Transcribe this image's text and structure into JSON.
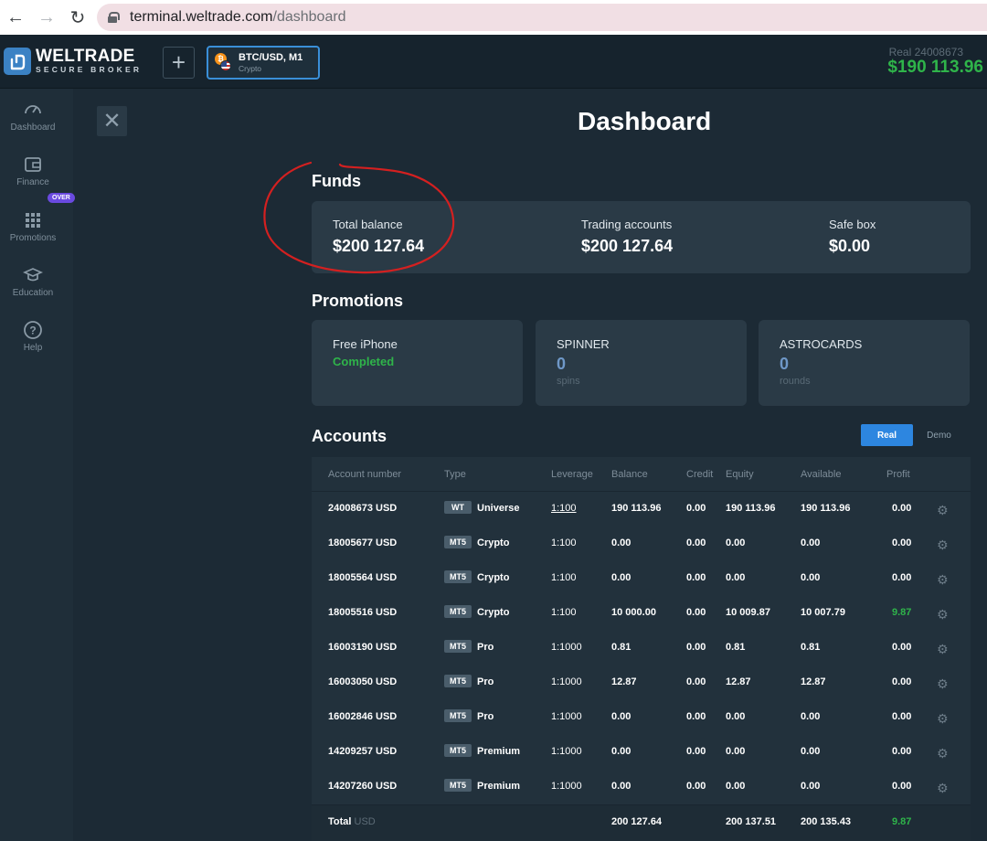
{
  "browser": {
    "url_host": "terminal.weltrade.com",
    "url_path": "/dashboard"
  },
  "header": {
    "logo_name": "WELTRADE",
    "logo_sub": "SECURE BROKER",
    "add_tab": "+",
    "instrument": {
      "name": "BTC/USD, M1",
      "category": "Crypto"
    },
    "account_label": "Real 24008673",
    "account_balance": "$190 113.96"
  },
  "sidebar": {
    "items": [
      {
        "label": "Dashboard",
        "icon": "speedometer-icon"
      },
      {
        "label": "Finance",
        "icon": "wallet-icon"
      },
      {
        "label": "Promotions",
        "icon": "grid-icon"
      },
      {
        "label": "Education",
        "icon": "graduation-cap-icon"
      },
      {
        "label": "Help",
        "icon": "help-circle-icon"
      }
    ],
    "badge": "OVER"
  },
  "page": {
    "title": "Dashboard",
    "close": "✕"
  },
  "funds": {
    "title": "Funds",
    "total_balance": {
      "label": "Total balance",
      "value": "$200 127.64"
    },
    "trading_accounts": {
      "label": "Trading accounts",
      "value": "$200 127.64"
    },
    "safe_box": {
      "label": "Safe box",
      "value": "$0.00"
    }
  },
  "promotions": {
    "title": "Promotions",
    "items": [
      {
        "name": "Free iPhone",
        "status": "Completed"
      },
      {
        "name": "SPINNER",
        "count": "0",
        "unit": "spins"
      },
      {
        "name": "ASTROCARDS",
        "count": "0",
        "unit": "rounds"
      }
    ]
  },
  "accounts": {
    "title": "Accounts",
    "toggle": {
      "real": "Real",
      "demo": "Demo"
    },
    "columns": [
      "Account number",
      "Type",
      "Leverage",
      "Balance",
      "Credit",
      "Equity",
      "Available",
      "Profit"
    ],
    "rows": [
      {
        "number": "24008673 USD",
        "platform": "WT",
        "type": "Universe",
        "leverage": "1:100",
        "balance": "190 113.96",
        "credit": "0.00",
        "equity": "190 113.96",
        "available": "190 113.96",
        "profit": "0.00"
      },
      {
        "number": "18005677 USD",
        "platform": "MT5",
        "type": "Crypto",
        "leverage": "1:100",
        "balance": "0.00",
        "credit": "0.00",
        "equity": "0.00",
        "available": "0.00",
        "profit": "0.00"
      },
      {
        "number": "18005564 USD",
        "platform": "MT5",
        "type": "Crypto",
        "leverage": "1:100",
        "balance": "0.00",
        "credit": "0.00",
        "equity": "0.00",
        "available": "0.00",
        "profit": "0.00"
      },
      {
        "number": "18005516 USD",
        "platform": "MT5",
        "type": "Crypto",
        "leverage": "1:100",
        "balance": "10 000.00",
        "credit": "0.00",
        "equity": "10 009.87",
        "available": "10 007.79",
        "profit": "9.87"
      },
      {
        "number": "16003190 USD",
        "platform": "MT5",
        "type": "Pro",
        "leverage": "1:1000",
        "balance": "0.81",
        "credit": "0.00",
        "equity": "0.81",
        "available": "0.81",
        "profit": "0.00"
      },
      {
        "number": "16003050 USD",
        "platform": "MT5",
        "type": "Pro",
        "leverage": "1:1000",
        "balance": "12.87",
        "credit": "0.00",
        "equity": "12.87",
        "available": "12.87",
        "profit": "0.00"
      },
      {
        "number": "16002846 USD",
        "platform": "MT5",
        "type": "Pro",
        "leverage": "1:1000",
        "balance": "0.00",
        "credit": "0.00",
        "equity": "0.00",
        "available": "0.00",
        "profit": "0.00"
      },
      {
        "number": "14209257 USD",
        "platform": "MT5",
        "type": "Premium",
        "leverage": "1:1000",
        "balance": "0.00",
        "credit": "0.00",
        "equity": "0.00",
        "available": "0.00",
        "profit": "0.00"
      },
      {
        "number": "14207260 USD",
        "platform": "MT5",
        "type": "Premium",
        "leverage": "1:1000",
        "balance": "0.00",
        "credit": "0.00",
        "equity": "0.00",
        "available": "0.00",
        "profit": "0.00"
      }
    ],
    "total": {
      "label": "Total",
      "currency": "USD",
      "balance": "200 127.64",
      "equity": "200 137.51",
      "available": "200 135.43",
      "profit": "9.87"
    }
  },
  "colors": {
    "positive": "#2fb44a",
    "accent": "#2d86e0",
    "annotation": "#d42020"
  }
}
